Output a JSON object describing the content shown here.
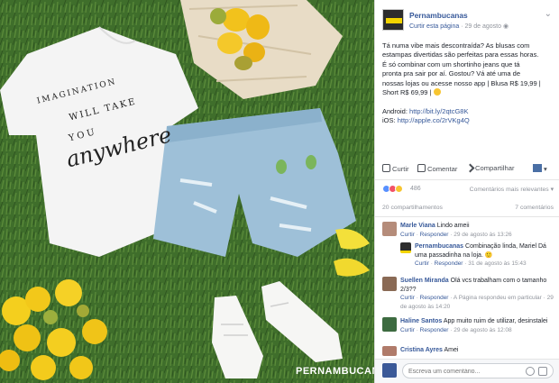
{
  "post": {
    "page_name": "Pernambucanas",
    "follow_label": "Curtir esta página",
    "date": "29 de agosto",
    "text_lines": [
      "Tá numa vibe mais descontraída? As blusas com",
      "estampas divertidas são perfeitas para essas horas.",
      "É só combinar com um shortinho jeans que tá",
      "pronta pra sair por aí. Gostou? Vá até uma de",
      "nossas lojas ou acesse nosso app | Blusa R$ 19,99 |",
      "Short R$ 69,99 |"
    ],
    "android_label": "Android:",
    "android_link": "http://bit.ly/2qtcG8K",
    "ios_label": "iOS:",
    "ios_link": "http://apple.co/2rVKg4Q"
  },
  "photo": {
    "tee_words": [
      "IMAGINATION",
      "WILL TAKE",
      "YOU",
      "anywhere"
    ],
    "watermark": "PERNAMBUCANAS"
  },
  "actions": {
    "like": "Curtir",
    "comment": "Comentar",
    "share": "Compartilhar"
  },
  "reactions": {
    "count": "486",
    "relevant": "Comentários mais relevantes"
  },
  "shares": {
    "count": "20 compartilhamentos",
    "comments": "7 comentários"
  },
  "comments": [
    {
      "name": "Marle Viana",
      "text": "Lindo ameii",
      "meta_like": "Curtir",
      "meta_reply": "Responder",
      "meta_date": "29 de agosto às 13:26"
    },
    {
      "name": "Pernambucanas",
      "text": "Combinação linda, Mariel Dá uma passadinha na loja. 🙂",
      "meta_like": "Curtir",
      "meta_reply": "Responder",
      "meta_date": "31 de agosto às 15:43"
    },
    {
      "name": "Suellen Miranda",
      "text": "Olá vcs trabalham com o tamanho 2/3??",
      "meta_like": "Curtir",
      "meta_reply": "Responder",
      "meta_note": "A Página respondeu em particular",
      "meta_date": "29 de agosto às 14:20"
    },
    {
      "name": "Haline Santos",
      "text": "App muito ruim de utilizar, desinstalei",
      "meta_like": "Curtir",
      "meta_reply": "Responder",
      "meta_date": "29 de agosto às 12:08"
    },
    {
      "name": "Cristina Ayres",
      "text": "Amei"
    }
  ],
  "write_comment": {
    "placeholder": "Escreva um comentário..."
  },
  "colors": {
    "link": "#365899",
    "muted": "#90949c",
    "brand_yellow": "#f3d400"
  }
}
